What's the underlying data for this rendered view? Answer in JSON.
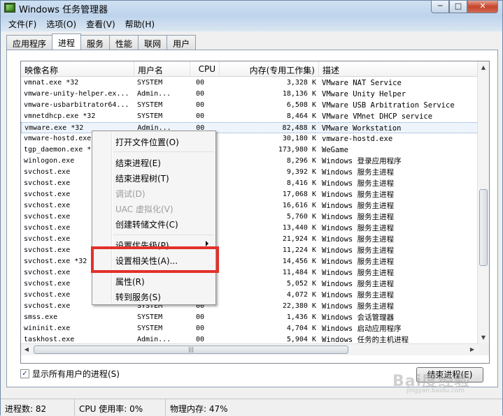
{
  "window": {
    "title": "Windows 任务管理器",
    "caption_min": "─",
    "caption_max": "□",
    "caption_close": "✕"
  },
  "menubar": {
    "items": [
      "文件(F)",
      "选项(O)",
      "查看(V)",
      "帮助(H)"
    ]
  },
  "tabs": [
    {
      "label": "应用程序",
      "active": false
    },
    {
      "label": "进程",
      "active": true
    },
    {
      "label": "服务",
      "active": false
    },
    {
      "label": "性能",
      "active": false
    },
    {
      "label": "联网",
      "active": false
    },
    {
      "label": "用户",
      "active": false
    }
  ],
  "columns": {
    "name": "映像名称",
    "user": "用户名",
    "cpu": "CPU",
    "mem": "内存(专用工作集)",
    "desc": "描述"
  },
  "processes": [
    {
      "name": "vmnat.exe *32",
      "user": "SYSTEM",
      "cpu": "00",
      "mem": "3,328 K",
      "desc": "VMware NAT Service"
    },
    {
      "name": "vmware-unity-helper.ex...",
      "user": "Admin...",
      "cpu": "00",
      "mem": "18,136 K",
      "desc": "VMware Unity Helper"
    },
    {
      "name": "vmware-usbarbitrator64...",
      "user": "SYSTEM",
      "cpu": "00",
      "mem": "6,508 K",
      "desc": "VMware USB Arbitration Service"
    },
    {
      "name": "vmnetdhcp.exe *32",
      "user": "SYSTEM",
      "cpu": "00",
      "mem": "8,464 K",
      "desc": "VMware VMnet DHCP service"
    },
    {
      "name": "vmware.exe *32",
      "user": "Admin...",
      "cpu": "00",
      "mem": "82,488 K",
      "desc": "VMware Workstation",
      "selected": true
    },
    {
      "name": "vmware-hostd.exe",
      "user": "",
      "cpu": "",
      "mem": "30,180 K",
      "desc": "vmware-hostd.exe"
    },
    {
      "name": "tgp_daemon.exe *",
      "user": "",
      "cpu": "",
      "mem": "173,980 K",
      "desc": "WeGame"
    },
    {
      "name": "winlogon.exe",
      "user": "",
      "cpu": "",
      "mem": "8,296 K",
      "desc": "Windows 登录应用程序"
    },
    {
      "name": "svchost.exe",
      "user": "",
      "cpu": "",
      "mem": "9,392 K",
      "desc": "Windows 服务主进程"
    },
    {
      "name": "svchost.exe",
      "user": "",
      "cpu": "",
      "mem": "8,416 K",
      "desc": "Windows 服务主进程"
    },
    {
      "name": "svchost.exe",
      "user": "",
      "cpu": "",
      "mem": "17,068 K",
      "desc": "Windows 服务主进程"
    },
    {
      "name": "svchost.exe",
      "user": "",
      "cpu": "",
      "mem": "16,616 K",
      "desc": "Windows 服务主进程"
    },
    {
      "name": "svchost.exe",
      "user": "",
      "cpu": "",
      "mem": "5,760 K",
      "desc": "Windows 服务主进程"
    },
    {
      "name": "svchost.exe",
      "user": "",
      "cpu": "",
      "mem": "13,440 K",
      "desc": "Windows 服务主进程"
    },
    {
      "name": "svchost.exe",
      "user": "",
      "cpu": "",
      "mem": "21,924 K",
      "desc": "Windows 服务主进程"
    },
    {
      "name": "svchost.exe",
      "user": "",
      "cpu": "",
      "mem": "11,224 K",
      "desc": "Windows 服务主进程"
    },
    {
      "name": "svchost.exe *32",
      "user": "",
      "cpu": "",
      "mem": "14,456 K",
      "desc": "Windows 服务主进程"
    },
    {
      "name": "svchost.exe",
      "user": "",
      "cpu": "",
      "mem": "11,484 K",
      "desc": "Windows 服务主进程"
    },
    {
      "name": "svchost.exe",
      "user": "",
      "cpu": "",
      "mem": "5,052 K",
      "desc": "Windows 服务主进程"
    },
    {
      "name": "svchost.exe",
      "user": "",
      "cpu": "",
      "mem": "4,072 K",
      "desc": "Windows 服务主进程"
    },
    {
      "name": "svchost.exe",
      "user": "SYSTEM",
      "cpu": "00",
      "mem": "22,380 K",
      "desc": "Windows 服务主进程"
    },
    {
      "name": "smss.exe",
      "user": "SYSTEM",
      "cpu": "00",
      "mem": "1,436 K",
      "desc": "Windows 会话管理器"
    },
    {
      "name": "wininit.exe",
      "user": "SYSTEM",
      "cpu": "00",
      "mem": "4,704 K",
      "desc": "Windows 启动应用程序"
    },
    {
      "name": "taskhost.exe",
      "user": "Admin...",
      "cpu": "00",
      "mem": "5,904 K",
      "desc": "Windows 任务的主机进程"
    }
  ],
  "context_menu": {
    "open_location": "打开文件位置(O)",
    "end_process": "结束进程(E)",
    "end_tree": "结束进程树(T)",
    "debug": "调试(D)",
    "uac": "UAC 虚拟化(V)",
    "dump": "创建转储文件(C)",
    "priority": "设置优先级(P)",
    "affinity": "设置相关性(A)...",
    "properties": "属性(R)",
    "goto_service": "转到服务(S)"
  },
  "footer": {
    "show_all_label": "显示所有用户的进程(S)",
    "show_all_checked": "✓",
    "end_button": "结束进程(E)"
  },
  "status": {
    "processes": "进程数: 82",
    "cpu": "CPU 使用率: 0%",
    "memory": "物理内存: 47%"
  },
  "watermark": {
    "brand": "Bai度经验",
    "sub": "jingyan.baidu.com"
  },
  "icons": {
    "scroll_up": "▲",
    "scroll_down": "▼",
    "scroll_left": "◀",
    "scroll_right": "▶",
    "grip": "|||"
  },
  "colors": {
    "highlight_box": "#e3302b",
    "selection": "#7da2ce"
  }
}
